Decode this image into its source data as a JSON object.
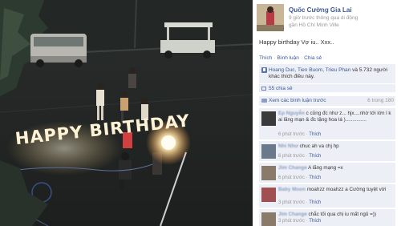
{
  "post": {
    "page_name": "Quốc Cường Gia Lai",
    "meta_line1": "9 giờ trước thông qua di động",
    "meta_line2": "gần Hồ Chí Minh Ville",
    "caption": "Happy birthday Vợ iu.. Xxx..",
    "actions": {
      "like": "Thích",
      "comment": "Bình luận",
      "share": "Chia sẻ",
      "separator": "·"
    },
    "likes": {
      "names": "Hoang Duc, Tien Buom, Trieu Phan",
      "text": "và 5.732 người khác thích điều này."
    },
    "shares": "55 chia sẻ",
    "view_previous": "Xem các bình luận trước",
    "comment_count": "6 trong 180"
  },
  "photo_text": "HAPPY BIRTHDAY",
  "comments": [
    {
      "name": "Ep Nguyễn",
      "text": "c cũng đc như z... hjx....nhờ tới lớn l k ai lãng mạn & đc tặng hoa lá )...............",
      "time": "6 phút trước",
      "like": "Thích",
      "avatar_color": "#3a3a3a"
    },
    {
      "name": "Nhi Như",
      "text": "chuc ah va chj hp",
      "time": "6 phút trước",
      "like": "Thích",
      "avatar_color": "#6a7a8a"
    },
    {
      "name": "Jim Change",
      "text": "A lãng mạng =x",
      "time": "6 phút trước",
      "like": "Thích",
      "avatar_color": "#8a7a6a"
    },
    {
      "name": "Baby Moon",
      "text": "moahzz moahzz a Cường tuyệt vời",
      "time": "3 phút trước",
      "like": "Thích",
      "avatar_color": "#a05050"
    },
    {
      "name": "Jim Change",
      "text": "chắc tối qua chị iu mất ngủ =))",
      "time": "3 phút trước",
      "like": "Thích",
      "avatar_color": "#8a7a6a"
    }
  ],
  "colors": {
    "link_blue": "#3b5998",
    "panel_bg": "#eceff5",
    "meta_grey": "#999999",
    "candle_glow": "#fff3d6"
  }
}
